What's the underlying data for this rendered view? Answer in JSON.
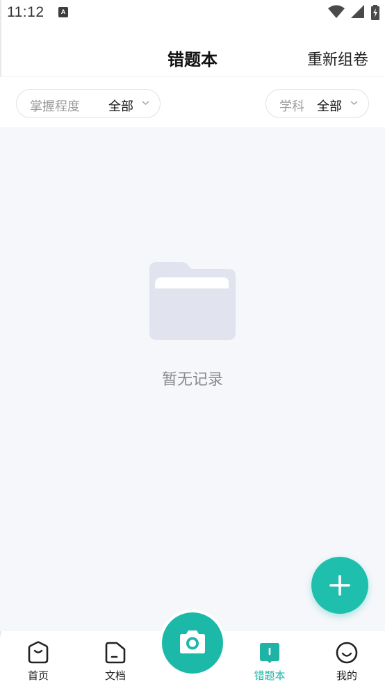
{
  "status_bar": {
    "time": "11:12",
    "notification_icon": "A"
  },
  "header": {
    "title": "错题本",
    "regroup_label": "重新组卷"
  },
  "filters": {
    "mastery": {
      "label": "掌握程度",
      "value": "全部"
    },
    "subject": {
      "label": "学科",
      "value": "全部"
    }
  },
  "empty_state": {
    "text": "暂无记录"
  },
  "bottom_nav": {
    "items": [
      {
        "label": "首页",
        "icon": "home-face-icon",
        "active": false
      },
      {
        "label": "文档",
        "icon": "document-icon",
        "active": false
      },
      {
        "label": "",
        "icon": "camera-icon",
        "active": false
      },
      {
        "label": "错题本",
        "icon": "notebook-icon",
        "active": true
      },
      {
        "label": "我的",
        "icon": "smile-face-icon",
        "active": false
      }
    ]
  },
  "colors": {
    "accent": "#1fbfae",
    "content_bg": "#f6f7fb",
    "muted_text": "#8a8a8a"
  }
}
